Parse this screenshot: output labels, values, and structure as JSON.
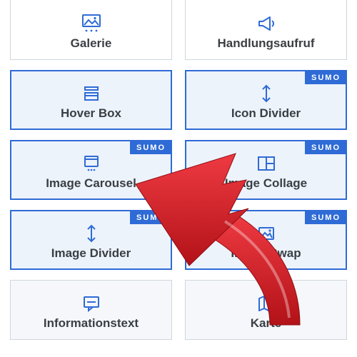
{
  "badge_text": "SUMO",
  "tiles": [
    {
      "id": "galerie",
      "label": "Galerie",
      "icon": "gallery-icon",
      "selected": false,
      "badge": false,
      "noborder": true
    },
    {
      "id": "handlungsaufruf",
      "label": "Handlungsaufruf",
      "icon": "megaphone-icon",
      "selected": false,
      "badge": false,
      "noborder": true
    },
    {
      "id": "hover-box",
      "label": "Hover Box",
      "icon": "hoverbox-icon",
      "selected": true,
      "badge": false,
      "noborder": false
    },
    {
      "id": "icon-divider",
      "label": "Icon Divider",
      "icon": "divider-icon",
      "selected": true,
      "badge": true,
      "noborder": false
    },
    {
      "id": "image-carousel",
      "label": "Image Carousel",
      "icon": "carousel-icon",
      "selected": true,
      "badge": true,
      "noborder": false
    },
    {
      "id": "image-collage",
      "label": "Image Collage",
      "icon": "collage-icon",
      "selected": true,
      "badge": true,
      "noborder": false
    },
    {
      "id": "image-divider",
      "label": "Image Divider",
      "icon": "divider-icon",
      "selected": true,
      "badge": true,
      "noborder": false
    },
    {
      "id": "image-swap",
      "label": "Image Swap",
      "icon": "imageswap-icon",
      "selected": true,
      "badge": true,
      "noborder": false
    },
    {
      "id": "informationstext",
      "label": "Informationstext",
      "icon": "infotext-icon",
      "selected": false,
      "badge": false,
      "noborder": false
    },
    {
      "id": "karte",
      "label": "Karte",
      "icon": "map-icon",
      "selected": false,
      "badge": false,
      "noborder": false
    }
  ],
  "colors": {
    "accent": "#2f6bd6",
    "arrow": "#d9262f"
  }
}
